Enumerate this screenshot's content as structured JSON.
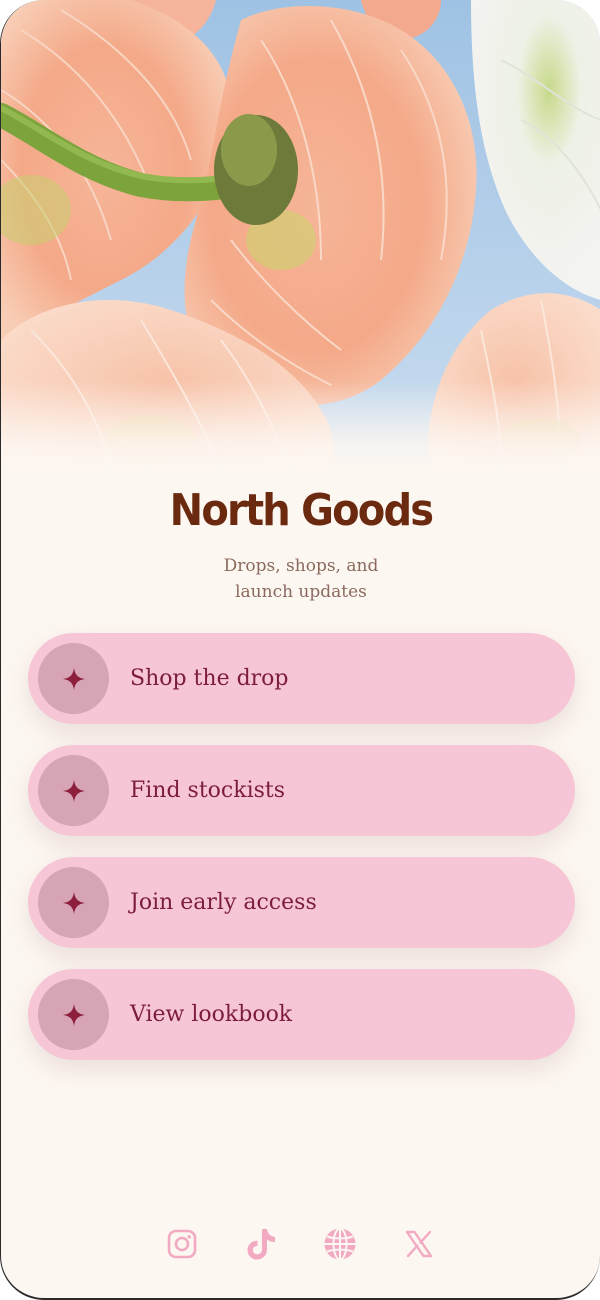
{
  "profile": {
    "title": "North Goods",
    "tagline_line1": "Drops, shops, and",
    "tagline_line2": "launch updates"
  },
  "links": [
    {
      "label": "Shop the drop",
      "icon": "sparkle-icon"
    },
    {
      "label": "Find stockists",
      "icon": "sparkle-icon"
    },
    {
      "label": "Join early access",
      "icon": "sparkle-icon"
    },
    {
      "label": "View lookbook",
      "icon": "sparkle-icon"
    }
  ],
  "social": [
    {
      "icon": "instagram-icon"
    },
    {
      "icon": "tiktok-icon"
    },
    {
      "icon": "globe-icon"
    },
    {
      "icon": "x-icon"
    }
  ],
  "colors": {
    "background": "#fdf7f2",
    "title": "#6b2a10",
    "tagline": "#8a6a5e",
    "button": "#f7c6d6",
    "button_icon_bg": "#d7a4b6",
    "button_text": "#7c1d3c",
    "social_icon": "#f2a9c2",
    "hero_sky": "#a9c9e6"
  }
}
